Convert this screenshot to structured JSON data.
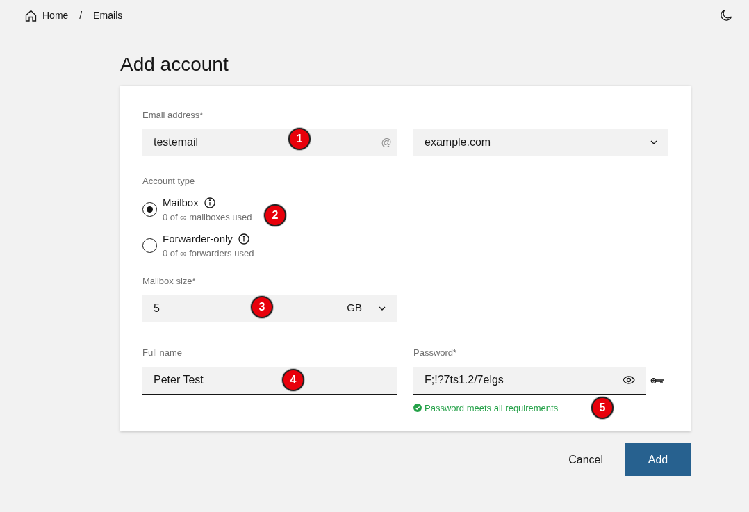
{
  "breadcrumb": [
    {
      "label": "Home",
      "kind": "home"
    },
    {
      "label": "Emails",
      "kind": "page"
    }
  ],
  "breadcrumb_separator": "/",
  "title": "Add account",
  "email": {
    "label": "Email address*",
    "value": "testemail",
    "suffix": "@",
    "domain": "example.com",
    "marker": "1"
  },
  "account_type": {
    "label": "Account type",
    "marker": "2",
    "options": [
      {
        "label": "Mailbox",
        "hint": "0 of ∞ mailboxes used",
        "selected": true
      },
      {
        "label": "Forwarder-only",
        "hint": "0 of ∞ forwarders used",
        "selected": false
      }
    ]
  },
  "mailbox_size": {
    "label": "Mailbox size*",
    "value": "5",
    "unit": "GB",
    "marker": "3"
  },
  "full_name": {
    "label": "Full name",
    "value": "Peter Test",
    "marker": "4"
  },
  "password": {
    "label": "Password*",
    "value": "F;!?7ts1.2/7elgs",
    "status": "Password meets all requirements",
    "valid": true,
    "marker": "5"
  },
  "buttons": [
    {
      "label": "Cancel",
      "kind": "link"
    },
    {
      "label": "Add",
      "kind": "primary"
    }
  ]
}
